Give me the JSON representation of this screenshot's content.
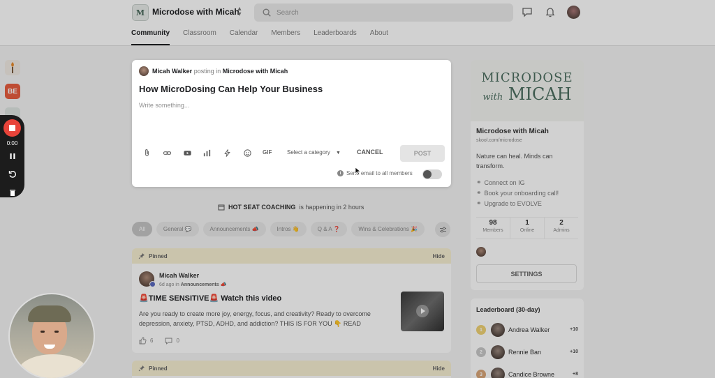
{
  "header": {
    "logo_text": "M",
    "group_name": "Microdose with Micah",
    "search_placeholder": "Search",
    "tabs": [
      {
        "label": "Community",
        "active": true
      },
      {
        "label": "Classroom",
        "active": false
      },
      {
        "label": "Calendar",
        "active": false
      },
      {
        "label": "Members",
        "active": false
      },
      {
        "label": "Leaderboards",
        "active": false
      },
      {
        "label": "About",
        "active": false
      }
    ]
  },
  "rail": {
    "be_label": "BE"
  },
  "recorder": {
    "time": "0:00"
  },
  "composer": {
    "author": "Micah Walker",
    "posting_in": "posting in",
    "group": "Microdose with Micah",
    "title": "How MicroDosing Can Help Your Business",
    "body_placeholder": "Write something...",
    "gif_label": "GIF",
    "category_label": "Select a category",
    "cancel_label": "CANCEL",
    "post_label": "POST",
    "email_label": "Send email to all members",
    "email_toggle_on": false
  },
  "event": {
    "name": "HOT SEAT COACHING",
    "suffix": "is happening in 2 hours"
  },
  "filters": [
    {
      "label": "All",
      "active": true
    },
    {
      "label": "General 💬",
      "active": false
    },
    {
      "label": "Announcements 📣",
      "active": false
    },
    {
      "label": "Intros 👋",
      "active": false
    },
    {
      "label": "Q & A ❓",
      "active": false
    },
    {
      "label": "Wins & Celebrations 🎉",
      "active": false
    }
  ],
  "posts": [
    {
      "pinned_label": "Pinned",
      "hide_label": "Hide",
      "author": "Micah Walker",
      "time": "6d ago in",
      "category": "Announcements 📣",
      "title": "🚨TIME SENSITIVE🚨 Watch this video",
      "body": "Are you ready to create more joy, energy, focus, and creativity? Ready to overcome depression, anxiety, PTSD, ADHD, and addiction? THIS IS FOR YOU 👇 READ",
      "likes": "6",
      "comments": "0"
    },
    {
      "pinned_label": "Pinned",
      "hide_label": "Hide"
    }
  ],
  "group_card": {
    "banner_line1": "MICRODOSE",
    "banner_with": "with",
    "banner_line2": "MICAH",
    "name": "Microdose with Micah",
    "url": "skool.com/microdose",
    "description": "Nature can heal. Minds can transform.",
    "links": [
      "Connect on IG",
      "Book your onboarding call!",
      "Upgrade to EVOLVE"
    ],
    "stats": [
      {
        "num": "98",
        "label": "Members"
      },
      {
        "num": "1",
        "label": "Online"
      },
      {
        "num": "2",
        "label": "Admins"
      }
    ],
    "settings_label": "SETTINGS"
  },
  "leaderboard": {
    "title": "Leaderboard (30-day)",
    "rows": [
      {
        "rank": "1",
        "name": "Andrea Walker",
        "points": "+10"
      },
      {
        "rank": "2",
        "name": "Rennie Ban",
        "points": "+10"
      },
      {
        "rank": "3",
        "name": "Candice Browne",
        "points": "+8"
      }
    ]
  }
}
